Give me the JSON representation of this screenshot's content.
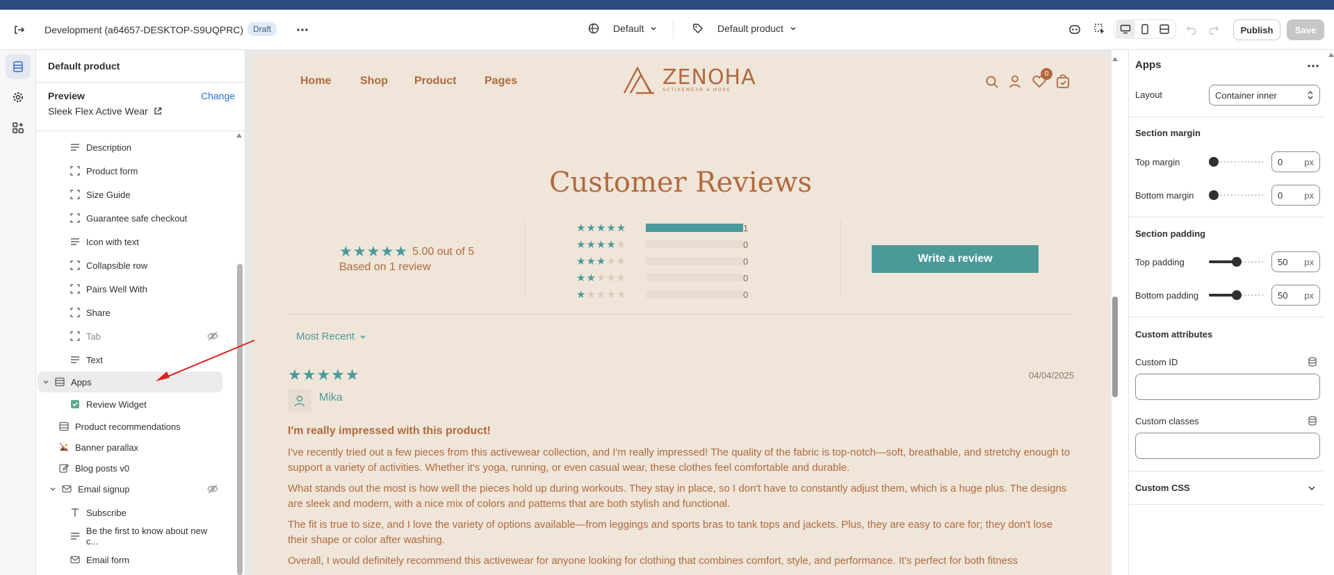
{
  "topbar": {
    "store_name": "Development (a64657-DESKTOP-S9UQPRC)",
    "status_badge": "Draft",
    "theme_select": "Default",
    "template_select": "Default product",
    "publish_label": "Publish",
    "save_label": "Save"
  },
  "left_panel": {
    "title": "Default product",
    "preview_label": "Preview",
    "change_label": "Change",
    "preview_product": "Sleek Flex Active Wear",
    "items": [
      {
        "label": "Description",
        "icon": "text-lines-icon"
      },
      {
        "label": "Product form",
        "icon": "dashed-square-icon"
      },
      {
        "label": "Size Guide",
        "icon": "dashed-square-icon"
      },
      {
        "label": "Guarantee safe checkout",
        "icon": "dashed-square-icon"
      },
      {
        "label": "Icon with text",
        "icon": "text-lines-icon"
      },
      {
        "label": "Collapsible row",
        "icon": "dashed-square-icon"
      },
      {
        "label": "Pairs Well With",
        "icon": "dashed-square-icon"
      },
      {
        "label": "Share",
        "icon": "dashed-square-icon"
      },
      {
        "label": "Tab",
        "icon": "dashed-square-icon"
      },
      {
        "label": "Text",
        "icon": "text-lines-icon"
      },
      {
        "label": "Apps",
        "icon": "section-icon"
      },
      {
        "label": "Review Widget",
        "icon": "app-block-icon"
      },
      {
        "label": "Product recommendations",
        "icon": "section-icon"
      },
      {
        "label": "Banner parallax",
        "icon": "image-icon"
      },
      {
        "label": "Blog posts v0",
        "icon": "edit-icon"
      },
      {
        "label": "Email signup",
        "icon": "mail-icon"
      },
      {
        "label": "Subscribe",
        "icon": "heading-icon"
      },
      {
        "label": "Be the first to know about new c...",
        "icon": "text-lines-icon"
      },
      {
        "label": "Email form",
        "icon": "mail-icon"
      }
    ]
  },
  "store": {
    "nav": [
      "Home",
      "Shop",
      "Product",
      "Pages"
    ],
    "logo_name": "ZENOHA",
    "logo_tagline": "ACTIVEWEAR & MORE",
    "cart_count": "0",
    "reviews_title": "Customer Reviews",
    "rating_text": "5.00 out of 5",
    "based_on": "Based on 1 review",
    "rating_bars": [
      {
        "stars": 5,
        "count": "1",
        "fraction": 1.0
      },
      {
        "stars": 4,
        "count": "0",
        "fraction": 0
      },
      {
        "stars": 3,
        "count": "0",
        "fraction": 0
      },
      {
        "stars": 2,
        "count": "0",
        "fraction": 0
      },
      {
        "stars": 1,
        "count": "0",
        "fraction": 0
      }
    ],
    "write_review": "Write a review",
    "sort_label": "Most Recent",
    "review": {
      "date": "04/04/2025",
      "author": "Mika",
      "title": "I'm really impressed with this product!",
      "paragraphs": [
        "I've recently tried out a few pieces from this activewear collection, and I'm really impressed! The quality of the fabric is top-notch—soft, breathable, and stretchy enough to support a variety of activities. Whether it's yoga, running, or even casual wear, these clothes feel comfortable and durable.",
        "What stands out the most is how well the pieces hold up during workouts. They stay in place, so I don't have to constantly adjust them, which is a huge plus. The designs are sleek and modern, with a nice mix of colors and patterns that are both stylish and functional.",
        "The fit is true to size, and I love the variety of options available—from leggings and sports bras to tank tops and jackets. Plus, they are easy to care for; they don't lose their shape or color after washing.",
        "Overall, I would definitely recommend this activewear for anyone looking for clothing that combines comfort, style, and performance. It's perfect for both fitness"
      ]
    }
  },
  "right_panel": {
    "title": "Apps",
    "layout_label": "Layout",
    "layout_value": "Container inner",
    "section_margin": "Section margin",
    "top_margin_label": "Top margin",
    "top_margin_value": "0",
    "bottom_margin_label": "Bottom margin",
    "bottom_margin_value": "0",
    "section_padding": "Section padding",
    "top_padding_label": "Top padding",
    "top_padding_value": "50",
    "bottom_padding_label": "Bottom padding",
    "bottom_padding_value": "50",
    "unit": "px",
    "custom_attributes": "Custom attributes",
    "custom_id_label": "Custom ID",
    "custom_classes_label": "Custom classes",
    "custom_css": "Custom CSS",
    "slider_levels": {
      "top_margin": 0,
      "bottom_margin": 0,
      "top_padding": 0.5,
      "bottom_padding": 0.5
    }
  },
  "colors": {
    "accent_teal": "#4b9a9a",
    "brand_brown": "#b06a3e",
    "store_bg": "#efe5d9",
    "annotation_arrow": "#e02020"
  }
}
